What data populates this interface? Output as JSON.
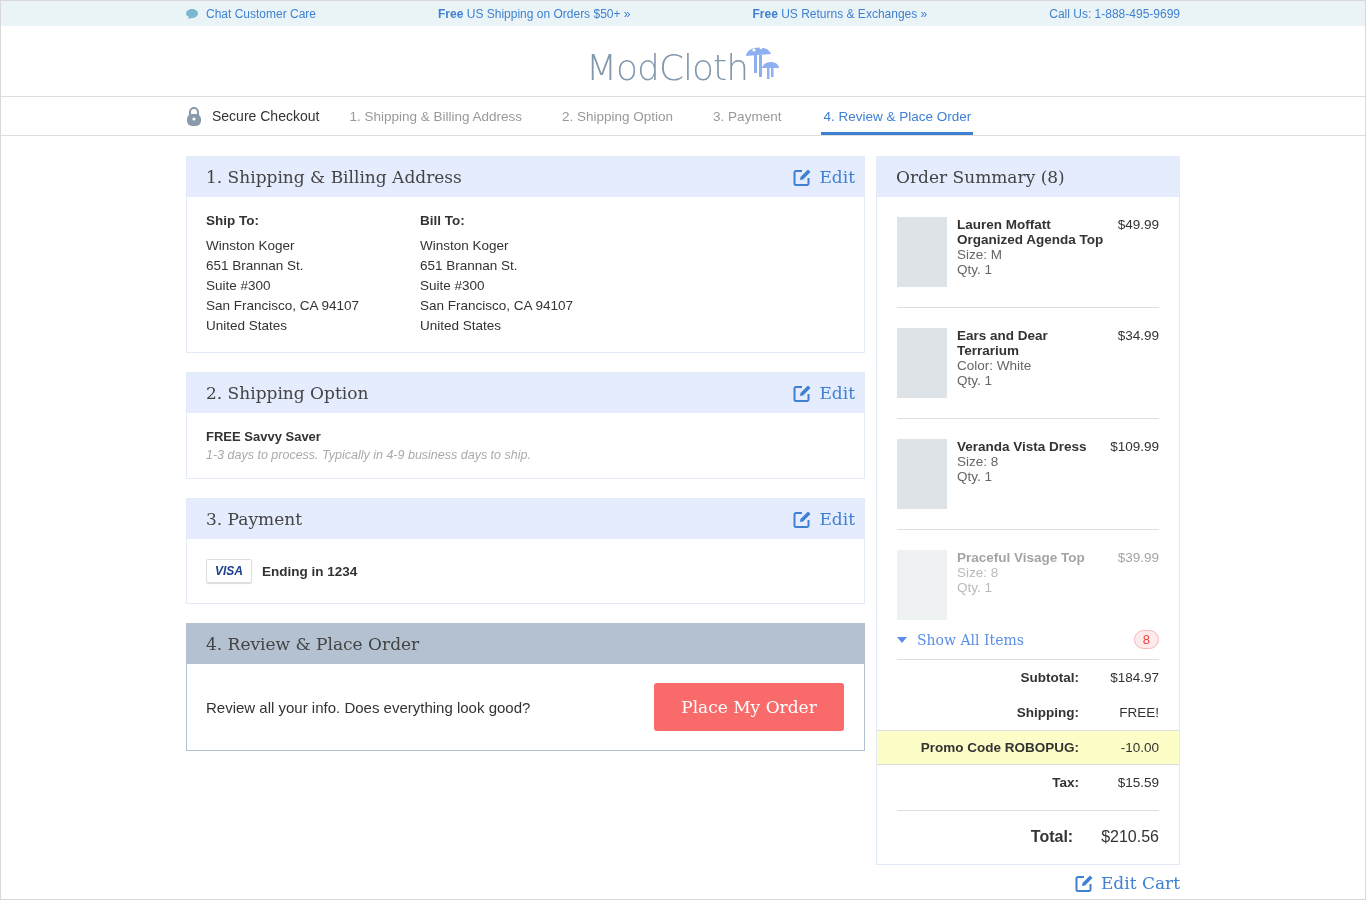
{
  "top_bar": {
    "chat": "Chat Customer Care",
    "promos": [
      "**Free** US Shipping on Orders $50+ »",
      "**Free** US Returns & Exchanges »"
    ],
    "phone": "Call Us: 1-888-495-9699"
  },
  "logo": "ModCloth",
  "checkout_steps": {
    "label": "Secure Checkout",
    "steps": [
      {
        "label": "1.  Shipping & Billing Address",
        "selected": false
      },
      {
        "label": "2. Shipping Option",
        "selected": false
      },
      {
        "label": "3. Payment",
        "selected": false
      },
      {
        "label": "4. Review & Place Order",
        "selected": true
      }
    ]
  },
  "sections": [
    {
      "kind": "address",
      "title": "1. Shipping & Billing Address",
      "current": false,
      "edit": "Edit",
      "columns": [
        {
          "heading": "Ship To:",
          "lines": [
            "Winston Koger",
            "651 Brannan St.",
            "Suite #300",
            "San Francisco, CA 94107",
            "United States"
          ]
        },
        {
          "heading": "Bill To:",
          "lines": [
            "Winston Koger",
            "651 Brannan St.",
            "Suite #300",
            "San Francisco, CA 94107",
            "United States"
          ]
        }
      ]
    },
    {
      "kind": "shipping",
      "title": "2. Shipping Option",
      "current": false,
      "edit": "Edit",
      "option": "FREE Savvy Saver",
      "note": "1-3 days to process. Typically in 4-9 business days to ship."
    },
    {
      "kind": "payment",
      "title": "3. Payment",
      "current": false,
      "edit": "Edit",
      "card": "VISA",
      "ending": "Ending in 1234"
    },
    {
      "kind": "review",
      "title": "4. Review & Place Order",
      "current": true,
      "prompt": "Review all your info. Does everything look good?",
      "button": "Place My Order"
    }
  ],
  "order_summary": {
    "title": "Order Summary (8)",
    "items": [
      {
        "name": "Lauren Moffatt Organized Agenda Top",
        "details": [
          "Size: M",
          "Qty. 1"
        ],
        "price": "$49.99",
        "faded": false
      },
      {
        "name": "Ears and Dear Terrarium",
        "details": [
          "Color: White",
          "Qty. 1"
        ],
        "price": "$34.99",
        "faded": false
      },
      {
        "name": "Veranda Vista Dress",
        "details": [
          "Size: 8",
          "Qty. 1"
        ],
        "price": "$109.99",
        "faded": false
      },
      {
        "name": "Praceful Visage Top",
        "details": [
          "Size: 8",
          "Qty. 1"
        ],
        "price": "$39.99",
        "faded": true
      }
    ],
    "show_all": "Show All Items",
    "count": "8",
    "totals": [
      {
        "kind": "line",
        "label": "Subtotal:",
        "value": "$184.97",
        "highlighted": false
      },
      {
        "kind": "line",
        "label": "Shipping:",
        "value": "FREE!",
        "highlighted": false
      },
      {
        "kind": "line",
        "label": "Promo Code ROBOPUG:",
        "value": "-10.00",
        "highlighted": true
      },
      {
        "kind": "line",
        "label": "Tax:",
        "value": "$15.59",
        "highlighted": false
      },
      {
        "kind": "total",
        "label": "Total:",
        "value": "$210.56",
        "highlighted": false
      }
    ],
    "edit_cart": "Edit Cart"
  }
}
